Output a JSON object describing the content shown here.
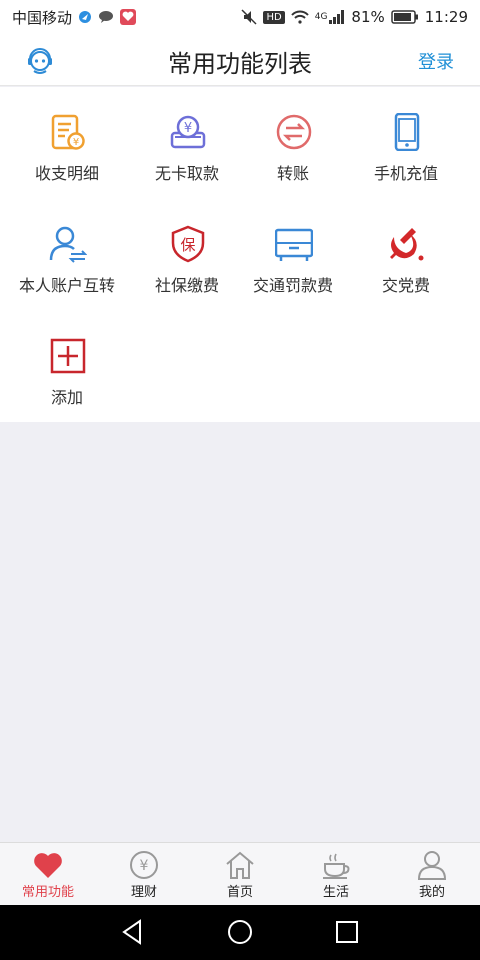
{
  "status": {
    "carrier": "中国移动",
    "battery": "81%",
    "time": "11:29",
    "network": "4G",
    "hd": "HD"
  },
  "header": {
    "title": "常用功能列表",
    "login": "登录",
    "service_icon": "customer-service-icon"
  },
  "functions": [
    {
      "label": "收支明细",
      "icon": "bill-icon"
    },
    {
      "label": "无卡取款",
      "icon": "atm-withdraw-icon"
    },
    {
      "label": "转账",
      "icon": "transfer-icon"
    },
    {
      "label": "手机充值",
      "icon": "phone-topup-icon"
    },
    {
      "label": "本人账户互转",
      "icon": "own-account-transfer-icon"
    },
    {
      "label": "社保缴费",
      "icon": "social-insurance-icon"
    },
    {
      "label": "交通罚款费",
      "icon": "traffic-fine-icon"
    },
    {
      "label": "交党费",
      "icon": "party-fee-icon"
    },
    {
      "label": "添加",
      "icon": "add-icon"
    }
  ],
  "tabs": [
    {
      "label": "常用功能",
      "icon": "heart-icon",
      "active": true
    },
    {
      "label": "理财",
      "icon": "yen-icon",
      "active": false
    },
    {
      "label": "首页",
      "icon": "home-icon",
      "active": false
    },
    {
      "label": "生活",
      "icon": "coffee-icon",
      "active": false
    },
    {
      "label": "我的",
      "icon": "user-icon",
      "active": false
    }
  ],
  "colors": {
    "accent": "#1f8fd6",
    "active_tab": "#e0414b",
    "orange": "#f0a030",
    "purple": "#6d6fd8",
    "red": "#c8262c",
    "blue": "#3a88d6"
  }
}
